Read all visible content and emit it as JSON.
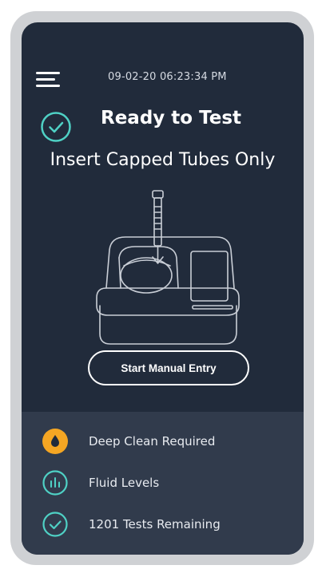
{
  "header": {
    "datetime": "09-02-20 06:23:34 PM"
  },
  "status": {
    "title": "Ready to Test",
    "instruction": "Insert Capped Tubes Only"
  },
  "actions": {
    "manual_entry_label": "Start Manual Entry"
  },
  "panel": {
    "items": [
      {
        "label": "Deep Clean Required",
        "icon": "drop-icon",
        "color": "#f5a623"
      },
      {
        "label": "Fluid Levels",
        "icon": "bar-chart-icon",
        "color": "#4fd1c5"
      },
      {
        "label": "1201 Tests Remaining",
        "icon": "check-icon",
        "color": "#4fd1c5"
      }
    ]
  },
  "colors": {
    "screen_bg": "#212b3b",
    "panel_bg": "#313b4c",
    "accent_teal": "#4fd1c5",
    "warning_orange": "#f5a623"
  }
}
